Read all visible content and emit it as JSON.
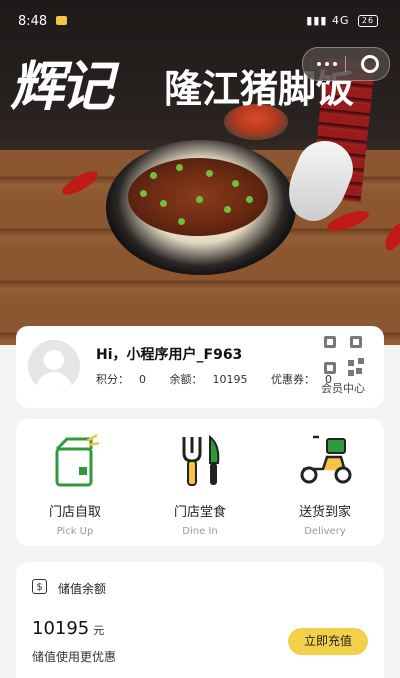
{
  "status_bar": {
    "time": "8:48",
    "network": "4G",
    "battery": "26"
  },
  "hero": {
    "brand_script": "辉记",
    "brand_name": "隆江猪脚饭"
  },
  "user": {
    "greeting": "Hi，小程序用户_F963",
    "points_label": "积分：",
    "points": "0",
    "balance_label": "余额：",
    "balance": "10195",
    "coupon_label": "优惠券：",
    "coupons": "0",
    "member_center": "会员中心"
  },
  "services": [
    {
      "cn": "门店自取",
      "en": "Pick Up",
      "icon": "shopping-bag-icon"
    },
    {
      "cn": "门店堂食",
      "en": "Dine In",
      "icon": "fork-knife-icon"
    },
    {
      "cn": "送货到家",
      "en": "Delivery",
      "icon": "scooter-icon"
    }
  ],
  "balance_card": {
    "title": "储值余额",
    "amount": "10195",
    "unit": "元",
    "subtitle": "储值使用更优惠",
    "recharge_button": "立即充值"
  },
  "colors": {
    "accent": "#f2d04a",
    "icon_green": "#2f9a3a",
    "icon_yellow": "#f5c443"
  }
}
